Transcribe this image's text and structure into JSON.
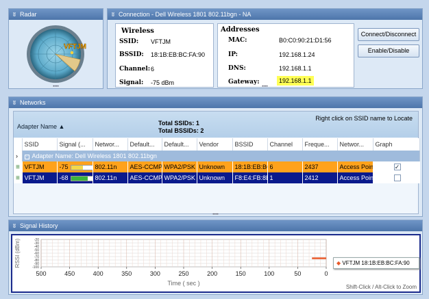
{
  "radar": {
    "title": "Radar",
    "ssid_label": "VFTJM"
  },
  "connection": {
    "title": "Connection - Dell Wireless 1801 802.11bgn - NA",
    "wireless": {
      "heading": "Wireless",
      "ssid_label": "SSID:",
      "ssid": "VFTJM",
      "bssid_label": "BSSID:",
      "bssid": "18:1B:EB:BC:FA:90",
      "channel_label": "Channel:",
      "channel": "6",
      "signal_label": "Signal:",
      "signal": "-75 dBm"
    },
    "addresses": {
      "heading": "Addresses",
      "mac_label": "MAC:",
      "mac": "B0:C0:90:21:D1:56",
      "ip_label": "IP:",
      "ip": "192.168.1.24",
      "dns_label": "DNS:",
      "dns": "192.168.1.1",
      "gateway_label": "Gateway:",
      "gateway": "192.168.1.1"
    },
    "connect_button": "Connect/Disconnect",
    "enable_button": "Enable/Disable"
  },
  "networks": {
    "title": "Networks",
    "group_by": "Adapter Name ▲",
    "total_ssids": "Total SSIDs: 1",
    "total_bssids": "Total BSSIDs: 2",
    "hint": "Right click on SSID name to Locate",
    "columns": [
      "SSID",
      "Signal (...",
      "Networ...",
      "Default...",
      "Default...",
      "Vendor",
      "BSSID",
      "Channel",
      "Freque...",
      "Networ...",
      "Graph"
    ],
    "group_row": "Adapter Name: Dell Wireless 1801 802.11bgn",
    "rows": [
      {
        "ssid": "VFTJM",
        "signal": "-75",
        "signal_fraction": 0.55,
        "network": "802.11n",
        "security": "AES-CCMP",
        "auth": "WPA2/PSK",
        "vendor": "Unknown",
        "bssid": "18:1B:EB:BC:",
        "channel": "6",
        "frequency": "2437",
        "network_type": "Access Point",
        "graph_checked": true
      },
      {
        "ssid": "VFTJM",
        "signal": "-68",
        "signal_fraction": 0.75,
        "network": "802.11n",
        "security": "AES-CCMP",
        "auth": "WPA2/PSK",
        "vendor": "Unknown",
        "bssid": "F8:E4:FB:8E:",
        "channel": "1",
        "frequency": "2412",
        "network_type": "Access Point",
        "graph_checked": false
      }
    ]
  },
  "signal_history": {
    "title": "Signal History",
    "ylabel": "RSSI (dBm)",
    "y_ticks": [
      "-20",
      "-30",
      "-40",
      "-50",
      "-60",
      "-70",
      "-80",
      "-90",
      "-100"
    ],
    "xlabel": "Time ( sec )",
    "x_ticks": [
      "500",
      "450",
      "400",
      "350",
      "300",
      "250",
      "200",
      "150",
      "100",
      "50",
      "0"
    ],
    "legend": "VFTJM 18:1B:EB:BC:FA:90",
    "zoom_hint": "Shift-Click / Alt-Click to Zoom",
    "trace_color": "#e85a2a"
  },
  "colors": {
    "selected_row": "#ffa21c",
    "dark_row": "#0a1a8c",
    "gateway_highlight": "#ffff55"
  }
}
